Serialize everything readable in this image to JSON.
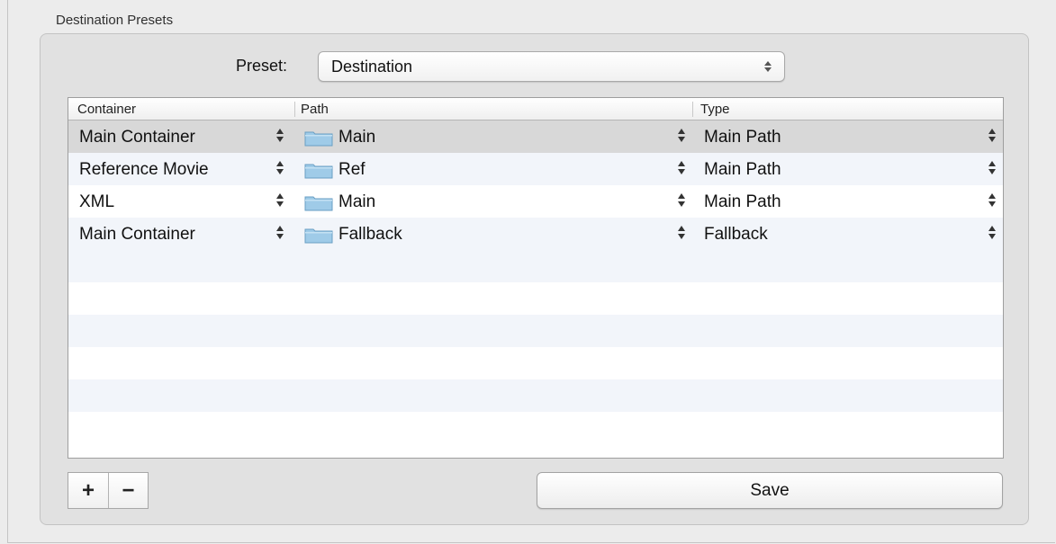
{
  "section": {
    "title": "Destination Presets"
  },
  "preset": {
    "label": "Preset:",
    "value": "Destination"
  },
  "table": {
    "columns": [
      "Container",
      "Path",
      "Type"
    ],
    "rows": [
      {
        "container": "Main Container",
        "path": "Main",
        "type": "Main Path",
        "selected": true
      },
      {
        "container": "Reference Movie",
        "path": "Ref",
        "type": "Main Path",
        "selected": false
      },
      {
        "container": "XML",
        "path": "Main",
        "type": "Main Path",
        "selected": false
      },
      {
        "container": "Main Container",
        "path": "Fallback",
        "type": "Fallback",
        "selected": false
      }
    ]
  },
  "buttons": {
    "add": "+",
    "remove": "−",
    "save": "Save"
  },
  "icons": {
    "path_cell": "folder-icon",
    "popup": "up-down-stepper-icon"
  },
  "colors": {
    "window_bg": "#ececec",
    "group_bg": "#e1e1e1",
    "selected_row": "#d8d8d8",
    "stripe": "#f2f5fa",
    "folder": "#9fcbe8"
  }
}
